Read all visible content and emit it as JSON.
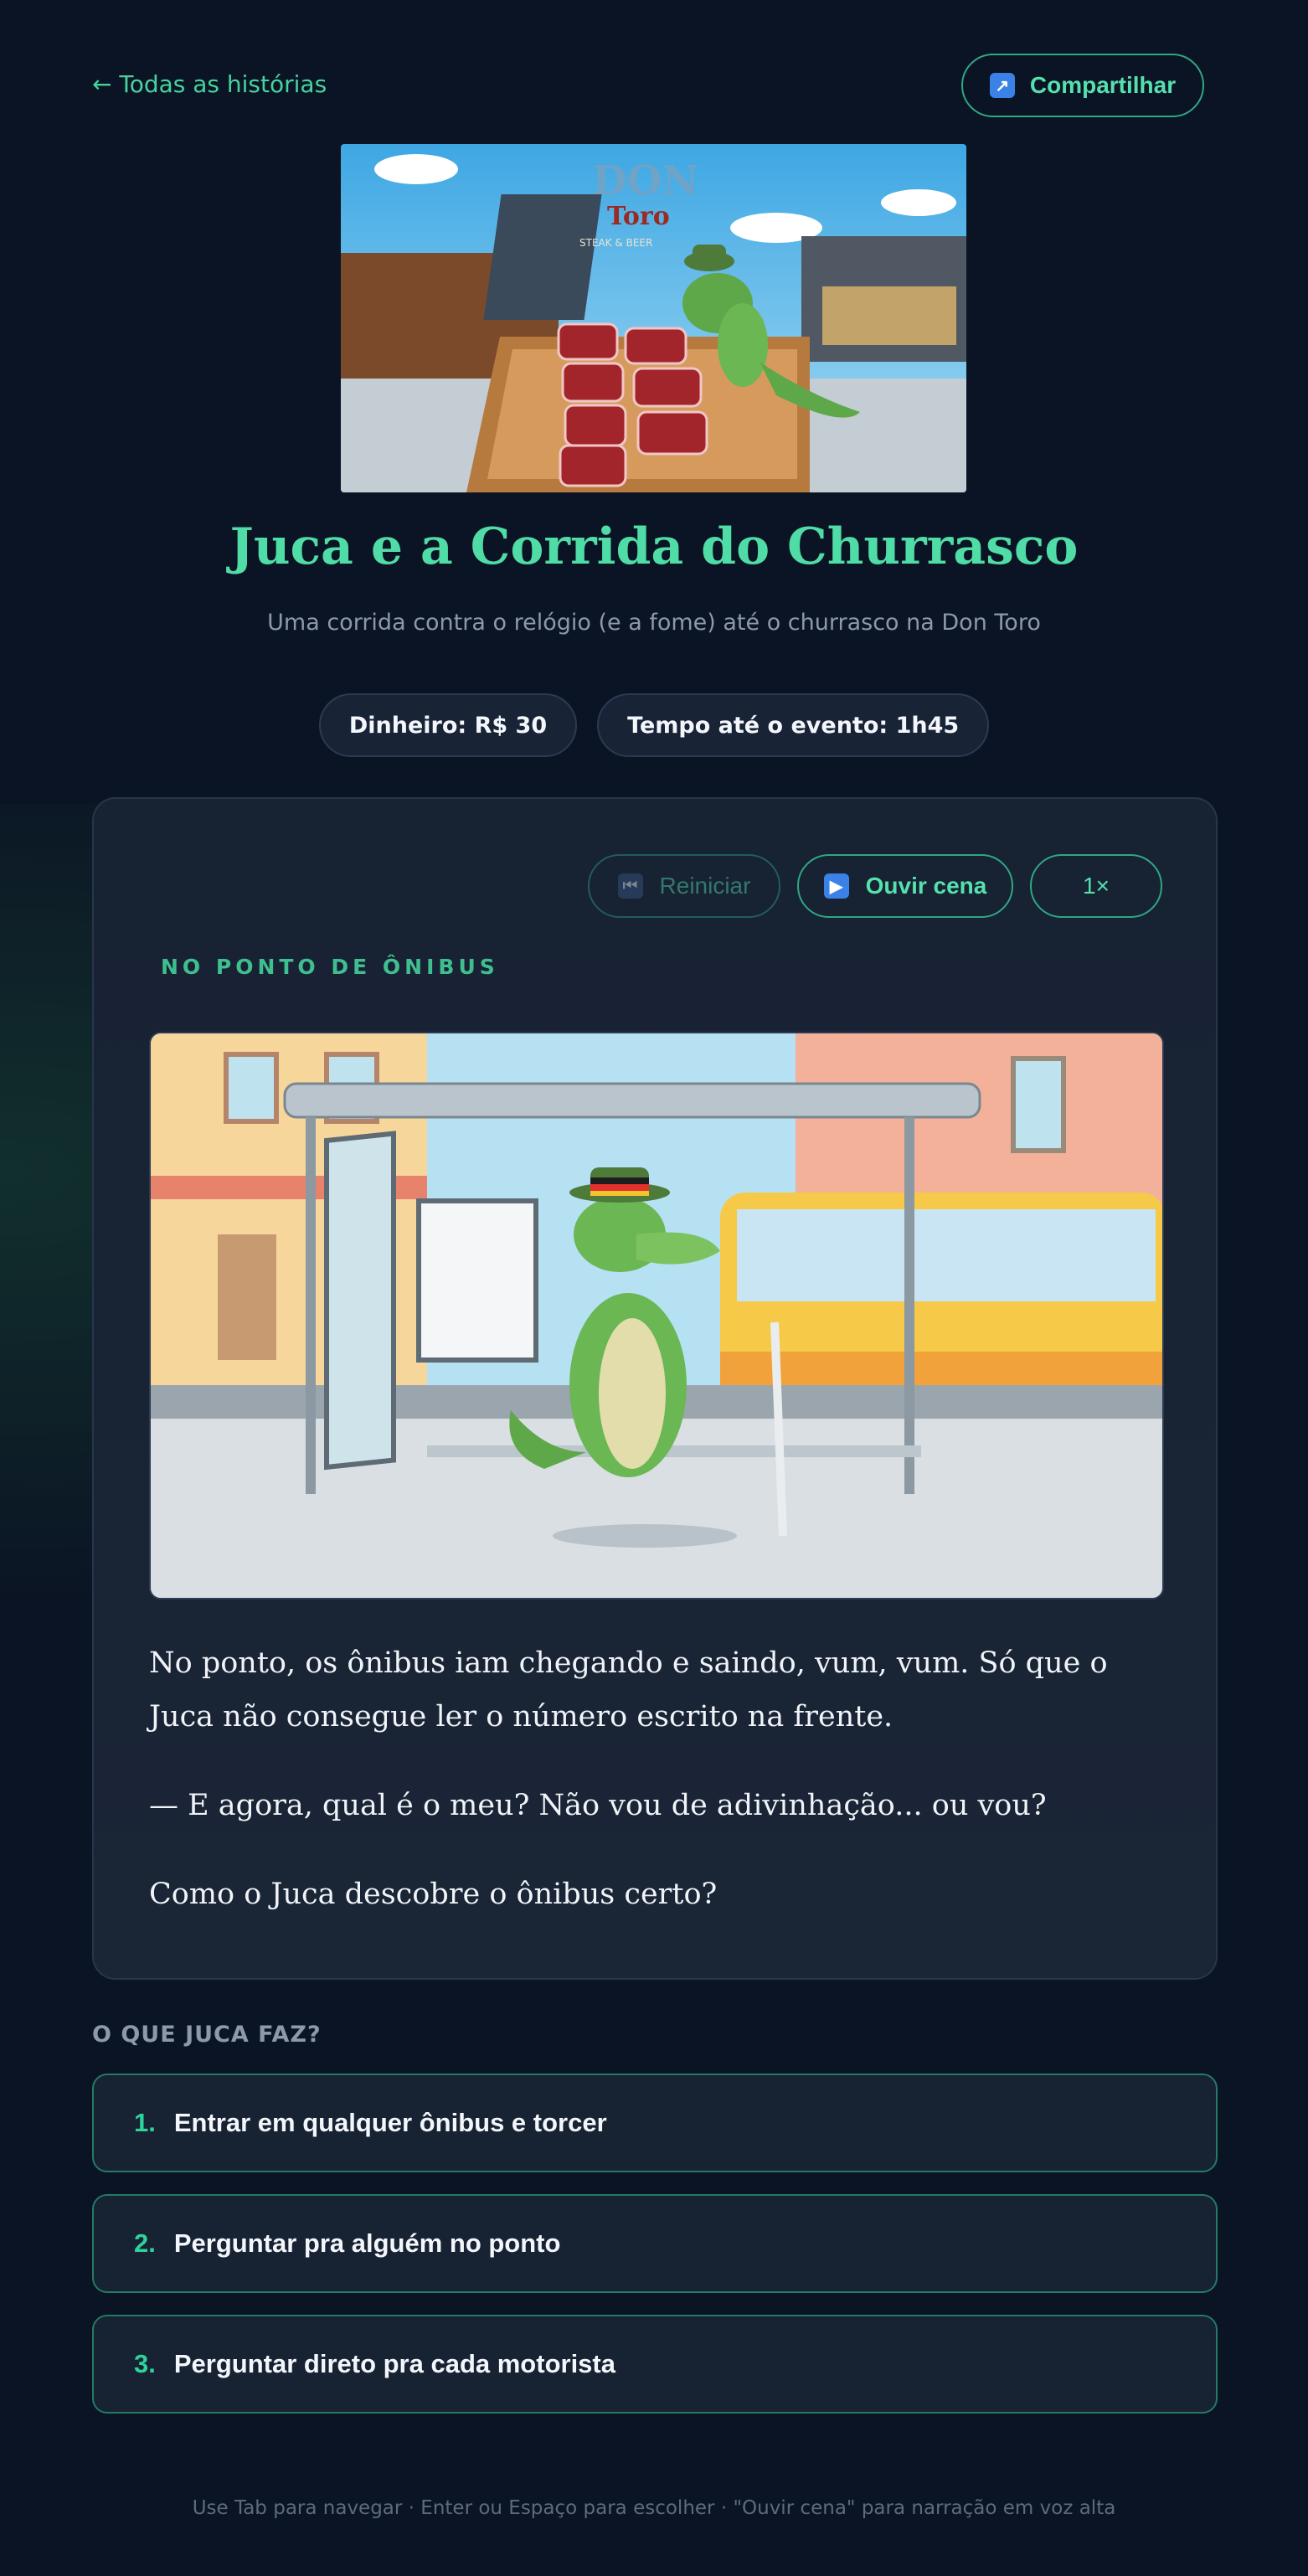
{
  "nav": {
    "back_label": "← Todas as histórias",
    "share_label": "Compartilhar",
    "share_icon": "share-arrow-icon"
  },
  "hero": {
    "sign_brand": "DON",
    "sign_sub": "Toro",
    "sign_tag": "STEAK & BEER"
  },
  "story": {
    "title": "Juca e a Corrida do Churrasco",
    "subtitle": "Uma corrida contra o relógio (e a fome) até o churrasco na Don Toro"
  },
  "stats": {
    "money": "Dinheiro: R$ 30",
    "time": "Tempo até o evento: 1h45"
  },
  "controls": {
    "restart_label": "Reiniciar",
    "listen_label": "Ouvir cena",
    "speed_label": "1×"
  },
  "scene": {
    "label": "NO PONTO DE ÔNIBUS",
    "paragraphs": [
      "No ponto, os ônibus iam chegando e saindo, vum, vum. Só que o Juca não consegue ler o número escrito na frente.",
      "— E agora, qual é o meu? Não vou de adivinhação... ou vou?",
      "Como o Juca descobre o ônibus certo?"
    ]
  },
  "choices": {
    "heading": "O QUE JUCA FAZ?",
    "items": [
      {
        "num": "1.",
        "label": "Entrar em qualquer ônibus e torcer"
      },
      {
        "num": "2.",
        "label": "Perguntar pra alguém no ponto"
      },
      {
        "num": "3.",
        "label": "Perguntar direto pra cada motorista"
      }
    ]
  },
  "footer": "Use Tab para navegar · Enter ou Espaço para escolher · \"Ouvir cena\" para narração em voz alta",
  "colors": {
    "background": "#0b1424",
    "accent": "#4fdca6",
    "card": "#172233",
    "border_accent": "#2fa784"
  }
}
